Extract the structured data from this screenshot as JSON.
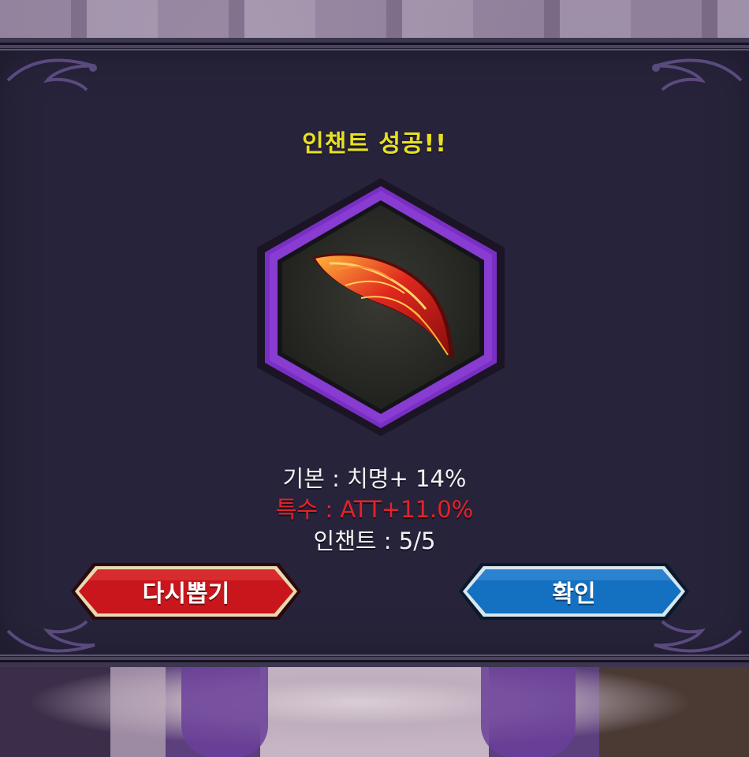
{
  "dialog": {
    "title": "인챈트 성공!!",
    "item_icon": "red-feather-icon",
    "stats": {
      "base": "기본 : 치명+ 14%",
      "special": "특수 : ATT+11.0%",
      "enchant": "인챈트 : 5/5"
    },
    "buttons": {
      "redraw_label": "다시뽑기",
      "confirm_label": "확인"
    }
  },
  "colors": {
    "title": "#e8e021",
    "special_stat": "#e4232b",
    "hex_border": "#7a2fc4",
    "redraw_button": "#c8161c",
    "confirm_button": "#1470c0",
    "panel": "#27233a"
  }
}
